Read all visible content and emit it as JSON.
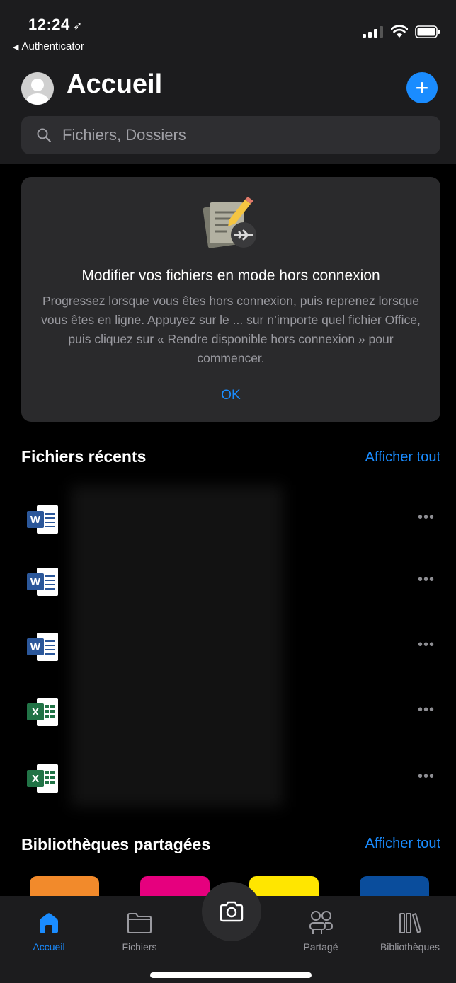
{
  "status": {
    "time": "12:24",
    "back_app": "Authenticator"
  },
  "header": {
    "title": "Accueil"
  },
  "search": {
    "placeholder": "Fichiers, Dossiers"
  },
  "offline_card": {
    "title": "Modifier vos fichiers en mode hors connexion",
    "body": "Progressez lorsque vous êtes hors connexion, puis reprenez lorsque vous êtes en ligne. Appuyez sur le ... sur n’importe quel fichier Office, puis cliquez sur « Rendre disponible hors connexion » pour commencer.",
    "ok": "OK"
  },
  "recent": {
    "title": "Fichiers récents",
    "see_all": "Afficher tout",
    "files": [
      {
        "type": "word",
        "name": ""
      },
      {
        "type": "word",
        "name": ""
      },
      {
        "type": "word",
        "name": ""
      },
      {
        "type": "excel",
        "name": ""
      },
      {
        "type": "excel",
        "name": ""
      }
    ],
    "more": "•••"
  },
  "libraries": {
    "title": "Bibliothèques partagées",
    "see_all": "Afficher tout",
    "tile_colors": [
      "#f28a2b",
      "#e6007e",
      "#ffe600",
      "#0a4d9c"
    ]
  },
  "tabbar": {
    "home": "Accueil",
    "files": "Fichiers",
    "shared": "Partagé",
    "libraries": "Bibliothèques"
  },
  "colors": {
    "accent": "#1a8cff",
    "word": "#2b579a",
    "excel": "#217346"
  }
}
